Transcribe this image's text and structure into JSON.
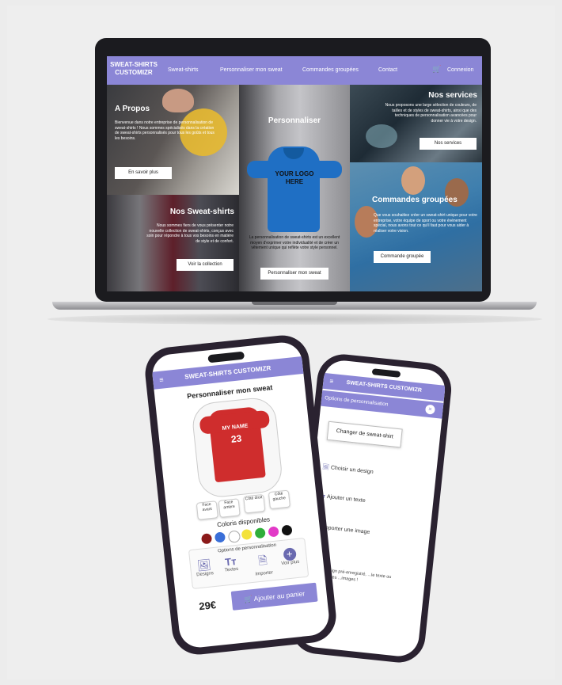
{
  "laptop": {
    "nav": {
      "brand": "SWEAT-SHIRTS CUSTOMIZR",
      "items": [
        "Sweat-shirts",
        "Personnaliser mon sweat",
        "Commandes groupées",
        "Contact"
      ],
      "login": "Connexion"
    },
    "about": {
      "title": "A Propos",
      "text": "Bienvenue dans notre entreprise de personnalisation de sweat-shirts ! Nous sommes spécialisés dans la création de sweat-shirts personnalisés pour tous les goûts et tous les besoins.",
      "button": "En savoir plus"
    },
    "customize": {
      "title": "Personnaliser",
      "hoodie_text": "YOUR LOGO HERE",
      "text": "La personnalisation de sweat-shirts est un excellent moyen d'exprimer votre individualité et de créer un vêtement unique qui reflète votre style personnel.",
      "button": "Personnaliser mon sweat"
    },
    "services": {
      "title": "Nos services",
      "text": "Nous proposons une large sélection de couleurs, de tailles et de styles de sweat-shirts, ainsi que des techniques de personnalisation avancées pour donner vie à votre design.",
      "button": "Nos services"
    },
    "sweatshirts": {
      "title": "Nos Sweat-shirts",
      "text": "Nous sommes fiers de vous présenter notre nouvelle collection de sweat-shirts, conçus avec soin pour répondre à tous vos besoins en matière de style et de confort.",
      "button": "Voir la collection"
    },
    "group": {
      "title": "Commandes groupées",
      "text": "Que vous souhaitiez créer un sweat-shirt unique pour votre entreprise, votre équipe de sport ou votre événement spécial, nous avons tout ce qu'il faut pour vous aider à réaliser votre vision.",
      "button": "Commande groupée"
    }
  },
  "phone1": {
    "header": "SWEAT-SHIRTS CUSTOMIZR",
    "title": "Personnaliser mon sweat",
    "shirt_name": "MY NAME",
    "shirt_number": "23",
    "faces": [
      "Face avant",
      "Face arrière",
      "Côté droit",
      "Côté gauche"
    ],
    "colors_title": "Coloris disponibles",
    "colors": [
      "#8b1a1a",
      "#3a6fd8",
      "#ffffff",
      "#f3e23a",
      "#2fae3a",
      "#e23ac7",
      "#111111"
    ],
    "options_title": "Options de personnalisation",
    "options": [
      "Designs",
      "Textes",
      "Importer",
      "Voir plus"
    ],
    "price": "29€",
    "cart_button": "Ajouter au panier"
  },
  "phone2": {
    "header": "SWEAT-SHIRTS CUSTOMIZR",
    "panel_title": "Options de personnalisation",
    "change_button": "Changer de sweat-shirt",
    "items": [
      "Choisir un design",
      "Ajouter un texte",
      "Importer une image"
    ],
    "footer_text": "...un design pré-enregistré, ...le texte ou vos propres ...images !"
  },
  "colors": {
    "accent": "#8b86d6"
  }
}
